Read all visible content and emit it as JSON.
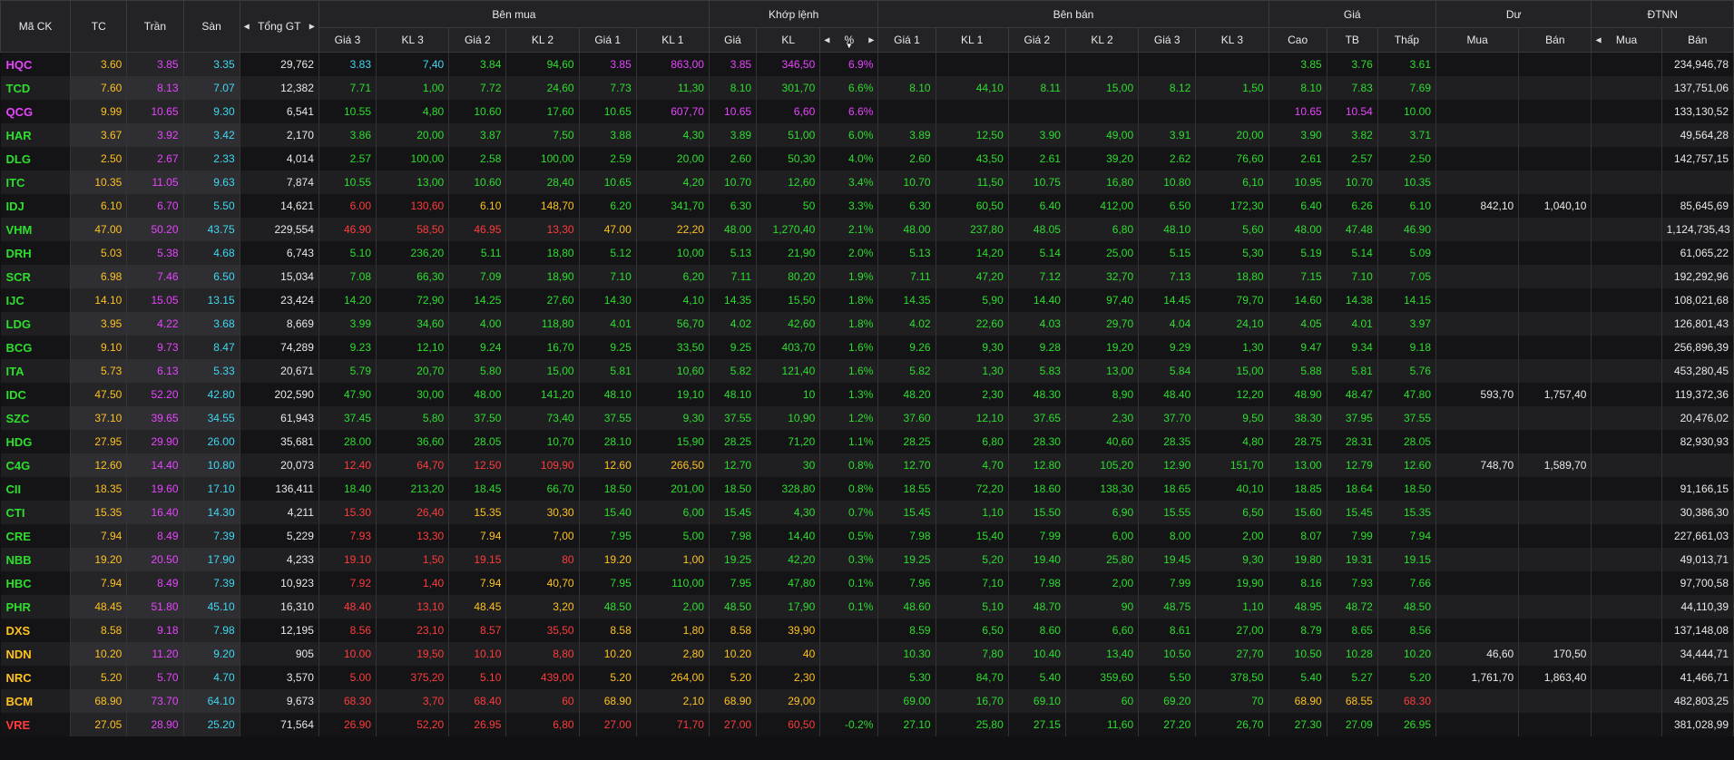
{
  "colors": {
    "up": "#2dde2d",
    "down": "#ff3b3b",
    "ref": "#ffc21c",
    "ceil": "#e844ff",
    "floor": "#3fd8f2",
    "white": "#e8e8e8"
  },
  "headers": {
    "symbol": "Mã CK",
    "ref": "TC",
    "ceil": "Trần",
    "floor": "Sàn",
    "total": "Tổng GT",
    "buy": "Bên mua",
    "match": "Khớp lệnh",
    "sell": "Bên bán",
    "price": "Giá",
    "remain": "Dư",
    "foreign": "ĐTNN",
    "buy_cols": [
      "Giá 3",
      "KL 3",
      "Giá 2",
      "KL 2",
      "Giá 1",
      "KL 1"
    ],
    "match_cols": [
      "Giá",
      "KL",
      "%"
    ],
    "sell_cols": [
      "Giá 1",
      "KL 1",
      "Giá 2",
      "KL 2",
      "Giá 3",
      "KL 3"
    ],
    "price_cols": [
      "Cao",
      "TB",
      "Thấp"
    ],
    "remain_cols": [
      "Mua",
      "Bán"
    ],
    "foreign_cols": [
      "Mua",
      "Bán"
    ]
  },
  "rows": [
    {
      "s": "HQC",
      "tc": "3.60",
      "tran": "3.85",
      "san": "3.35",
      "tgt": "29,762",
      "b3": "3.83",
      "bk3": "7,40",
      "b2": "3.84",
      "bk2": "94,60",
      "b1": "3.85",
      "bk1": "863,00",
      "mp": "3.85",
      "mk": "346,50",
      "pct": "6.9%",
      "s1": "",
      "sk1": "",
      "s2": "",
      "sk2": "",
      "s3": "",
      "sk3": "",
      "hi": "3.85",
      "tb": "3.76",
      "lo": "3.61",
      "dm": "",
      "db": "",
      "fm": "",
      "fb": "234,946,78",
      "c": "cffuuccc ccuuucc cuuu"
    },
    {
      "s": "TCD",
      "tc": "7.60",
      "tran": "8.13",
      "san": "7.07",
      "tgt": "12,382",
      "b3": "7.71",
      "bk3": "1,00",
      "b2": "7.72",
      "bk2": "24,60",
      "b1": "7.73",
      "bk1": "11,30",
      "mp": "8.10",
      "mk": "301,70",
      "pct": "6.6%",
      "s1": "8.10",
      "sk1": "44,10",
      "s2": "8.11",
      "sk2": "15,00",
      "s3": "8.12",
      "sk3": "1,50",
      "hi": "8.10",
      "tb": "7.83",
      "lo": "7.69",
      "dm": "",
      "db": "",
      "fm": "",
      "fb": "137,751,06",
      "c": "uuuuuuuuuuuuuuuuuuuuu"
    },
    {
      "s": "QCG",
      "tc": "9.99",
      "tran": "10.65",
      "san": "9.30",
      "tgt": "6,541",
      "b3": "10.55",
      "bk3": "4,80",
      "b2": "10.60",
      "bk2": "17,60",
      "b1": "10.65",
      "bk1": "607,70",
      "mp": "10.65",
      "mk": "6,60",
      "pct": "6.6%",
      "s1": "",
      "sk1": "",
      "s2": "",
      "sk2": "",
      "s3": "",
      "sk3": "",
      "hi": "10.65",
      "tb": "10.54",
      "lo": "10.00",
      "dm": "",
      "db": "",
      "fm": "",
      "fb": "133,130,52",
      "c": "cuuuuuccccuuuuuuccuuu"
    },
    {
      "s": "HAR",
      "tc": "3.67",
      "tran": "3.92",
      "san": "3.42",
      "tgt": "2,170",
      "b3": "3.86",
      "bk3": "20,00",
      "b2": "3.87",
      "bk2": "7,50",
      "b1": "3.88",
      "bk1": "4,30",
      "mp": "3.89",
      "mk": "51,00",
      "pct": "6.0%",
      "s1": "3.89",
      "sk1": "12,50",
      "s2": "3.90",
      "sk2": "49,00",
      "s3": "3.91",
      "sk3": "20,00",
      "hi": "3.90",
      "tb": "3.82",
      "lo": "3.71",
      "dm": "",
      "db": "",
      "fm": "",
      "fb": "49,564,28",
      "c": "uuuuuuuuuuuuuuuuuuuuu"
    },
    {
      "s": "DLG",
      "tc": "2.50",
      "tran": "2.67",
      "san": "2.33",
      "tgt": "4,014",
      "b3": "2.57",
      "bk3": "100,00",
      "b2": "2.58",
      "bk2": "100,00",
      "b1": "2.59",
      "bk1": "20,00",
      "mp": "2.60",
      "mk": "50,30",
      "pct": "4.0%",
      "s1": "2.60",
      "sk1": "43,50",
      "s2": "2.61",
      "sk2": "39,20",
      "s3": "2.62",
      "sk3": "76,60",
      "hi": "2.61",
      "tb": "2.57",
      "lo": "2.50",
      "dm": "",
      "db": "",
      "fm": "",
      "fb": "142,757,15",
      "c": "uuuuuuuuuuuuuuuuuuuur"
    },
    {
      "s": "ITC",
      "tc": "10.35",
      "tran": "11.05",
      "san": "9.63",
      "tgt": "7,874",
      "b3": "10.55",
      "bk3": "13,00",
      "b2": "10.60",
      "bk2": "28,40",
      "b1": "10.65",
      "bk1": "4,20",
      "mp": "10.70",
      "mk": "12,60",
      "pct": "3.4%",
      "s1": "10.70",
      "sk1": "11,50",
      "s2": "10.75",
      "sk2": "16,80",
      "s3": "10.80",
      "sk3": "6,10",
      "hi": "10.95",
      "tb": "10.70",
      "lo": "10.35",
      "dm": "",
      "db": "",
      "fm": "",
      "fb": "",
      "c": "uuuuuuuuuuuuuuuuuuuur"
    },
    {
      "s": "IDJ",
      "tc": "6.10",
      "tran": "6.70",
      "san": "5.50",
      "tgt": "14,621",
      "b3": "6.00",
      "bk3": "130,60",
      "b2": "6.10",
      "bk2": "148,70",
      "b1": "6.20",
      "bk1": "341,70",
      "mp": "6.30",
      "mk": "50",
      "pct": "3.3%",
      "s1": "6.30",
      "sk1": "60,50",
      "s2": "6.40",
      "sk2": "412,00",
      "s3": "6.50",
      "sk3": "172,30",
      "hi": "6.40",
      "tb": "6.26",
      "lo": "6.10",
      "dm": "842,10",
      "db": "1,040,10",
      "fm": "",
      "fb": "85,645,69",
      "c": "uddrruuuuuuuuuuuuuuur"
    },
    {
      "s": "VHM",
      "tc": "47.00",
      "tran": "50.20",
      "san": "43.75",
      "tgt": "229,554",
      "b3": "46.90",
      "bk3": "58,50",
      "b2": "46.95",
      "bk2": "13,30",
      "b1": "47.00",
      "bk1": "22,20",
      "mp": "48.00",
      "mk": "1,270,40",
      "pct": "2.1%",
      "s1": "48.00",
      "sk1": "237,80",
      "s2": "48.05",
      "sk2": "6,80",
      "s3": "48.10",
      "sk3": "5,60",
      "hi": "48.00",
      "tb": "47.48",
      "lo": "46.90",
      "dm": "",
      "db": "",
      "fm": "",
      "fb": "1,124,735,43",
      "c": "uddddrruuuuuuuuuuuuud"
    },
    {
      "s": "DRH",
      "tc": "5.03",
      "tran": "5.38",
      "san": "4.68",
      "tgt": "6,743",
      "b3": "5.10",
      "bk3": "236,20",
      "b2": "5.11",
      "bk2": "18,80",
      "b1": "5.12",
      "bk1": "10,00",
      "mp": "5.13",
      "mk": "21,90",
      "pct": "2.0%",
      "s1": "5.13",
      "sk1": "14,20",
      "s2": "5.14",
      "sk2": "25,00",
      "s3": "5.15",
      "sk3": "5,30",
      "hi": "5.19",
      "tb": "5.14",
      "lo": "5.09",
      "dm": "",
      "db": "",
      "fm": "",
      "fb": "61,065,22",
      "c": "uuuuuuuuuuuuuuuuuuuuu"
    },
    {
      "s": "SCR",
      "tc": "6.98",
      "tran": "7.46",
      "san": "6.50",
      "tgt": "15,034",
      "b3": "7.08",
      "bk3": "66,30",
      "b2": "7.09",
      "bk2": "18,90",
      "b1": "7.10",
      "bk1": "6,20",
      "mp": "7.11",
      "mk": "80,20",
      "pct": "1.9%",
      "s1": "7.11",
      "sk1": "47,20",
      "s2": "7.12",
      "sk2": "32,70",
      "s3": "7.13",
      "sk3": "18,80",
      "hi": "7.15",
      "tb": "7.10",
      "lo": "7.05",
      "dm": "",
      "db": "",
      "fm": "",
      "fb": "192,292,96",
      "c": "uuuuuuuuuuuuuuuuuuuuu"
    },
    {
      "s": "IJC",
      "tc": "14.10",
      "tran": "15.05",
      "san": "13.15",
      "tgt": "23,424",
      "b3": "14.20",
      "bk3": "72,90",
      "b2": "14.25",
      "bk2": "27,60",
      "b1": "14.30",
      "bk1": "4,10",
      "mp": "14.35",
      "mk": "15,50",
      "pct": "1.8%",
      "s1": "14.35",
      "sk1": "5,90",
      "s2": "14.40",
      "sk2": "97,40",
      "s3": "14.45",
      "sk3": "79,70",
      "hi": "14.60",
      "tb": "14.38",
      "lo": "14.15",
      "dm": "",
      "db": "",
      "fm": "",
      "fb": "108,021,68",
      "c": "uuuuuuuuuuuuuuuuuuuuu"
    },
    {
      "s": "LDG",
      "tc": "3.95",
      "tran": "4.22",
      "san": "3.68",
      "tgt": "8,669",
      "b3": "3.99",
      "bk3": "34,60",
      "b2": "4.00",
      "bk2": "118,80",
      "b1": "4.01",
      "bk1": "56,70",
      "mp": "4.02",
      "mk": "42,60",
      "pct": "1.8%",
      "s1": "4.02",
      "sk1": "22,60",
      "s2": "4.03",
      "sk2": "29,70",
      "s3": "4.04",
      "sk3": "24,10",
      "hi": "4.05",
      "tb": "4.01",
      "lo": "3.97",
      "dm": "",
      "db": "",
      "fm": "",
      "fb": "126,801,43",
      "c": "uuuuuuuuuuuuuuuuuuuuu"
    },
    {
      "s": "BCG",
      "tc": "9.10",
      "tran": "9.73",
      "san": "8.47",
      "tgt": "74,289",
      "b3": "9.23",
      "bk3": "12,10",
      "b2": "9.24",
      "bk2": "16,70",
      "b1": "9.25",
      "bk1": "33,50",
      "mp": "9.25",
      "mk": "403,70",
      "pct": "1.6%",
      "s1": "9.26",
      "sk1": "9,30",
      "s2": "9.28",
      "sk2": "19,20",
      "s3": "9.29",
      "sk3": "1,30",
      "hi": "9.47",
      "tb": "9.34",
      "lo": "9.18",
      "dm": "",
      "db": "",
      "fm": "",
      "fb": "256,896,39",
      "c": "uuuuuuuuuuuuuuuuuuuuu"
    },
    {
      "s": "ITA",
      "tc": "5.73",
      "tran": "6.13",
      "san": "5.33",
      "tgt": "20,671",
      "b3": "5.79",
      "bk3": "20,70",
      "b2": "5.80",
      "bk2": "15,00",
      "b1": "5.81",
      "bk1": "10,60",
      "mp": "5.82",
      "mk": "121,40",
      "pct": "1.6%",
      "s1": "5.82",
      "sk1": "1,30",
      "s2": "5.83",
      "sk2": "13,00",
      "s3": "5.84",
      "sk3": "15,00",
      "hi": "5.88",
      "tb": "5.81",
      "lo": "5.76",
      "dm": "",
      "db": "",
      "fm": "",
      "fb": "453,280,45",
      "c": "uuuuuuuuuuuuuuuuuuuuu"
    },
    {
      "s": "IDC",
      "tc": "47.50",
      "tran": "52.20",
      "san": "42.80",
      "tgt": "202,590",
      "b3": "47.90",
      "bk3": "30,00",
      "b2": "48.00",
      "bk2": "141,20",
      "b1": "48.10",
      "bk1": "19,10",
      "mp": "48.10",
      "mk": "10",
      "pct": "1.3%",
      "s1": "48.20",
      "sk1": "2,30",
      "s2": "48.30",
      "sk2": "8,90",
      "s3": "48.40",
      "sk3": "12,20",
      "hi": "48.90",
      "tb": "48.47",
      "lo": "47.80",
      "dm": "593,70",
      "db": "1,757,40",
      "fm": "",
      "fb": "119,372,36",
      "c": "uuuuuuuuuuuuuuuuuuuuu"
    },
    {
      "s": "SZC",
      "tc": "37.10",
      "tran": "39.65",
      "san": "34.55",
      "tgt": "61,943",
      "b3": "37.45",
      "bk3": "5,80",
      "b2": "37.50",
      "bk2": "73,40",
      "b1": "37.55",
      "bk1": "9,30",
      "mp": "37.55",
      "mk": "10,90",
      "pct": "1.2%",
      "s1": "37.60",
      "sk1": "12,10",
      "s2": "37.65",
      "sk2": "2,30",
      "s3": "37.70",
      "sk3": "9,50",
      "hi": "38.30",
      "tb": "37.95",
      "lo": "37.55",
      "dm": "",
      "db": "",
      "fm": "",
      "fb": "20,476,02",
      "c": "uuuuuuuuuuuuuuuuuuuuu"
    },
    {
      "s": "HDG",
      "tc": "27.95",
      "tran": "29.90",
      "san": "26.00",
      "tgt": "35,681",
      "b3": "28.00",
      "bk3": "36,60",
      "b2": "28.05",
      "bk2": "10,70",
      "b1": "28.10",
      "bk1": "15,90",
      "mp": "28.25",
      "mk": "71,20",
      "pct": "1.1%",
      "s1": "28.25",
      "sk1": "6,80",
      "s2": "28.30",
      "sk2": "40,60",
      "s3": "28.35",
      "sk3": "4,80",
      "hi": "28.75",
      "tb": "28.31",
      "lo": "28.05",
      "dm": "",
      "db": "",
      "fm": "",
      "fb": "82,930,93",
      "c": "uuuuuuuuuuuuuuuuuuuuu"
    },
    {
      "s": "C4G",
      "tc": "12.60",
      "tran": "14.40",
      "san": "10.80",
      "tgt": "20,073",
      "b3": "12.40",
      "bk3": "64,70",
      "b2": "12.50",
      "bk2": "109,90",
      "b1": "12.60",
      "bk1": "266,50",
      "mp": "12.70",
      "mk": "30",
      "pct": "0.8%",
      "s1": "12.70",
      "sk1": "4,70",
      "s2": "12.80",
      "sk2": "105,20",
      "s3": "12.90",
      "sk3": "151,70",
      "hi": "13.00",
      "tb": "12.79",
      "lo": "12.60",
      "dm": "748,70",
      "db": "1,589,70",
      "fm": "",
      "fb": "",
      "c": "uddddrruuuuuuuuuuuuur"
    },
    {
      "s": "CII",
      "tc": "18.35",
      "tran": "19.60",
      "san": "17.10",
      "tgt": "136,411",
      "b3": "18.40",
      "bk3": "213,20",
      "b2": "18.45",
      "bk2": "66,70",
      "b1": "18.50",
      "bk1": "201,00",
      "mp": "18.50",
      "mk": "328,80",
      "pct": "0.8%",
      "s1": "18.55",
      "sk1": "72,20",
      "s2": "18.60",
      "sk2": "138,30",
      "s3": "18.65",
      "sk3": "40,10",
      "hi": "18.85",
      "tb": "18.64",
      "lo": "18.50",
      "dm": "",
      "db": "",
      "fm": "",
      "fb": "91,166,15",
      "c": "uuuuuuuuuuuuuuuuuuuuu"
    },
    {
      "s": "CTI",
      "tc": "15.35",
      "tran": "16.40",
      "san": "14.30",
      "tgt": "4,211",
      "b3": "15.30",
      "bk3": "26,40",
      "b2": "15.35",
      "bk2": "30,30",
      "b1": "15.40",
      "bk1": "6,00",
      "mp": "15.45",
      "mk": "4,30",
      "pct": "0.7%",
      "s1": "15.45",
      "sk1": "1,10",
      "s2": "15.50",
      "sk2": "6,90",
      "s3": "15.55",
      "sk3": "6,50",
      "hi": "15.60",
      "tb": "15.45",
      "lo": "15.35",
      "dm": "",
      "db": "",
      "fm": "",
      "fb": "30,386,30",
      "c": "uddrruuuuuuuuuuuuuuur"
    },
    {
      "s": "CRE",
      "tc": "7.94",
      "tran": "8.49",
      "san": "7.39",
      "tgt": "5,229",
      "b3": "7.93",
      "bk3": "13,30",
      "b2": "7.94",
      "bk2": "7,00",
      "b1": "7.95",
      "bk1": "5,00",
      "mp": "7.98",
      "mk": "14,40",
      "pct": "0.5%",
      "s1": "7.98",
      "sk1": "15,40",
      "s2": "7.99",
      "sk2": "6,00",
      "s3": "8.00",
      "sk3": "2,00",
      "hi": "8.07",
      "tb": "7.99",
      "lo": "7.94",
      "dm": "",
      "db": "",
      "fm": "",
      "fb": "227,661,03",
      "c": "uddrruuuuuuuuuuuuuuur"
    },
    {
      "s": "NBB",
      "tc": "19.20",
      "tran": "20.50",
      "san": "17.90",
      "tgt": "4,233",
      "b3": "19.10",
      "bk3": "1,50",
      "b2": "19.15",
      "bk2": "80",
      "b1": "19.20",
      "bk1": "1,00",
      "mp": "19.25",
      "mk": "42,20",
      "pct": "0.3%",
      "s1": "19.25",
      "sk1": "5,20",
      "s2": "19.40",
      "sk2": "25,80",
      "s3": "19.45",
      "sk3": "9,30",
      "hi": "19.80",
      "tb": "19.31",
      "lo": "19.15",
      "dm": "",
      "db": "",
      "fm": "",
      "fb": "49,013,71",
      "c": "uddddrruuuuuuuuuuuuud"
    },
    {
      "s": "HBC",
      "tc": "7.94",
      "tran": "8.49",
      "san": "7.39",
      "tgt": "10,923",
      "b3": "7.92",
      "bk3": "1,40",
      "b2": "7.94",
      "bk2": "40,70",
      "b1": "7.95",
      "bk1": "110,00",
      "mp": "7.95",
      "mk": "47,80",
      "pct": "0.1%",
      "s1": "7.96",
      "sk1": "7,10",
      "s2": "7.98",
      "sk2": "2,00",
      "s3": "7.99",
      "sk3": "19,90",
      "hi": "8.16",
      "tb": "7.93",
      "lo": "7.66",
      "dm": "",
      "db": "",
      "fm": "",
      "fb": "97,700,58",
      "c": "uddrruuuuuuuuuuuuuudd"
    },
    {
      "s": "PHR",
      "tc": "48.45",
      "tran": "51.80",
      "san": "45.10",
      "tgt": "16,310",
      "b3": "48.40",
      "bk3": "13,10",
      "b2": "48.45",
      "bk2": "3,20",
      "b1": "48.50",
      "bk1": "2,00",
      "mp": "48.50",
      "mk": "17,90",
      "pct": "0.1%",
      "s1": "48.60",
      "sk1": "5,10",
      "s2": "48.70",
      "sk2": "90",
      "s3": "48.75",
      "sk3": "1,10",
      "hi": "48.95",
      "tb": "48.72",
      "lo": "48.50",
      "dm": "",
      "db": "",
      "fm": "",
      "fb": "44,110,39",
      "c": "uddrruuuuuuuuuuuuuuuu"
    },
    {
      "s": "DXS",
      "tc": "8.58",
      "tran": "9.18",
      "san": "7.98",
      "tgt": "12,195",
      "b3": "8.56",
      "bk3": "23,10",
      "b2": "8.57",
      "bk2": "35,50",
      "b1": "8.58",
      "bk1": "1,80",
      "mp": "8.58",
      "mk": "39,90",
      "pct": "",
      "s1": "8.59",
      "sk1": "6,50",
      "s2": "8.60",
      "sk2": "6,60",
      "s3": "8.61",
      "sk3": "27,00",
      "hi": "8.79",
      "tb": "8.65",
      "lo": "8.56",
      "dm": "",
      "db": "",
      "fm": "",
      "fb": "137,148,08",
      "c": "rddddrrrrruuuuuuuuuud"
    },
    {
      "s": "NDN",
      "tc": "10.20",
      "tran": "11.20",
      "san": "9.20",
      "tgt": "905",
      "b3": "10.00",
      "bk3": "19,50",
      "b2": "10.10",
      "bk2": "8,80",
      "b1": "10.20",
      "bk1": "2,80",
      "mp": "10.20",
      "mk": "40",
      "pct": "",
      "s1": "10.30",
      "sk1": "7,80",
      "s2": "10.40",
      "sk2": "13,40",
      "s3": "10.50",
      "sk3": "27,70",
      "hi": "10.50",
      "tb": "10.28",
      "lo": "10.20",
      "dm": "46,60",
      "db": "170,50",
      "fm": "",
      "fb": "34,444,71",
      "c": "rddddrrrrruuuuuuuuuur"
    },
    {
      "s": "NRC",
      "tc": "5.20",
      "tran": "5.70",
      "san": "4.70",
      "tgt": "3,570",
      "b3": "5.00",
      "bk3": "375,20",
      "b2": "5.10",
      "bk2": "439,00",
      "b1": "5.20",
      "bk1": "264,00",
      "mp": "5.20",
      "mk": "2,30",
      "pct": "",
      "s1": "5.30",
      "sk1": "84,70",
      "s2": "5.40",
      "sk2": "359,60",
      "s3": "5.50",
      "sk3": "378,50",
      "hi": "5.40",
      "tb": "5.27",
      "lo": "5.20",
      "dm": "1,761,70",
      "db": "1,863,40",
      "fm": "",
      "fb": "41,466,71",
      "c": "rddddrrrrruuuuuuuuuur"
    },
    {
      "s": "BCM",
      "tc": "68.90",
      "tran": "73.70",
      "san": "64.10",
      "tgt": "9,673",
      "b3": "68.30",
      "bk3": "3,70",
      "b2": "68.40",
      "bk2": "60",
      "b1": "68.90",
      "bk1": "2,10",
      "mp": "68.90",
      "mk": "29,00",
      "pct": "",
      "s1": "69.00",
      "sk1": "16,70",
      "s2": "69.10",
      "sk2": "60",
      "s3": "69.20",
      "sk3": "70",
      "hi": "68.90",
      "tb": "68.55",
      "lo": "68.30",
      "dm": "",
      "db": "",
      "fm": "",
      "fb": "482,803,25",
      "c": "rddddrrrrruuuuuurrddd"
    },
    {
      "s": "VRE",
      "tc": "27.05",
      "tran": "28.90",
      "san": "25.20",
      "tgt": "71,564",
      "b3": "26.90",
      "bk3": "52,20",
      "b2": "26.95",
      "bk2": "6,80",
      "b1": "27.00",
      "bk1": "71,70",
      "mp": "27.00",
      "mk": "60,50",
      "pct": "-0.2%",
      "s1": "27.10",
      "sk1": "25,80",
      "s2": "27.15",
      "sk2": "11,60",
      "s3": "27.20",
      "sk3": "26,70",
      "hi": "27.30",
      "tb": "27.09",
      "lo": "26.95",
      "dm": "",
      "db": "",
      "fm": "",
      "fb": "381,028,99",
      "c": "ddddddddduuuuuuuuuud"
    }
  ]
}
